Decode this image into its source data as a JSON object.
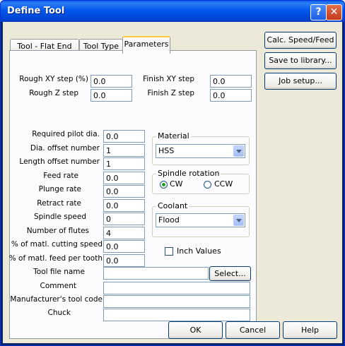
{
  "window": {
    "title": "Define Tool"
  },
  "side_buttons": {
    "calc": "Calc. Speed/Feed",
    "save": "Save to library...",
    "job": "Job setup..."
  },
  "tabs": [
    "Tool - Flat End Mill",
    "Tool Type",
    "Parameters"
  ],
  "active_tab": "Parameters",
  "steps": {
    "rough_xy_label": "Rough XY step (%)",
    "rough_xy": "0.0",
    "rough_z_label": "Rough Z step",
    "rough_z": "0.0",
    "finish_xy_label": "Finish XY step",
    "finish_xy": "0.0",
    "finish_z_label": "Finish Z step",
    "finish_z": "0.0"
  },
  "fields": [
    {
      "label": "Required pilot dia.",
      "value": "0.0"
    },
    {
      "label": "Dia. offset number",
      "value": "1"
    },
    {
      "label": "Length offset number",
      "value": "1"
    },
    {
      "label": "Feed rate",
      "value": "0.0"
    },
    {
      "label": "Plunge rate",
      "value": "0.0"
    },
    {
      "label": "Retract rate",
      "value": "0.0"
    },
    {
      "label": "Spindle speed",
      "value": "0"
    },
    {
      "label": "Number of flutes",
      "value": "4"
    },
    {
      "label": "% of matl. cutting speed",
      "value": "0.0"
    },
    {
      "label": "% of matl. feed per tooth",
      "value": "0.0"
    }
  ],
  "material": {
    "label": "Material",
    "value": "HSS"
  },
  "spindle_rotation": {
    "label": "Spindle rotation",
    "cw": "CW",
    "ccw": "CCW",
    "selected": "CW"
  },
  "coolant": {
    "label": "Coolant",
    "value": "Flood"
  },
  "inch_values": {
    "label": "Inch Values",
    "checked": false
  },
  "tool_file": {
    "label": "Tool file name",
    "value": "",
    "select_label": "Select..."
  },
  "comment": {
    "label": "Comment",
    "value": ""
  },
  "manufacturer": {
    "label": "Manufacturer's tool code",
    "value": ""
  },
  "chuck": {
    "label": "Chuck",
    "value": ""
  },
  "bottom_buttons": {
    "ok": "OK",
    "cancel": "Cancel",
    "help": "Help"
  },
  "colors": {
    "titlebar": "#0058ee",
    "dialog_bg": "#ece9d8",
    "tab_highlight": "#ffc83c"
  }
}
